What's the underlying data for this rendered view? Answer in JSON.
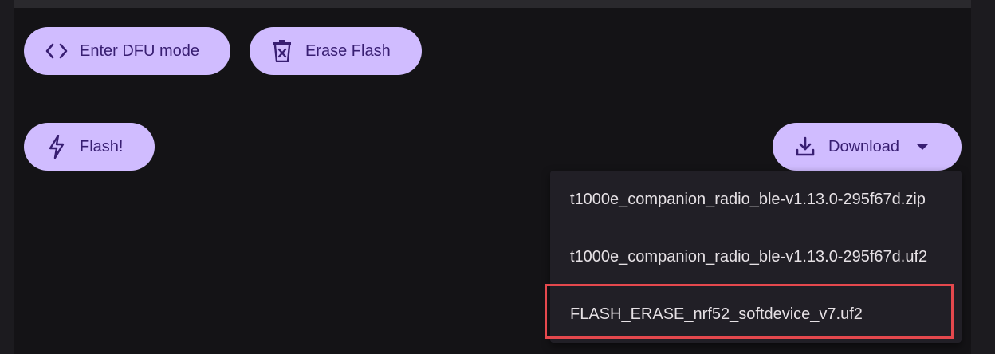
{
  "buttons": {
    "dfu": {
      "label": "Enter DFU mode",
      "icon": "code-icon"
    },
    "erase": {
      "label": "Erase Flash",
      "icon": "trash-icon"
    },
    "flash": {
      "label": "Flash!",
      "icon": "lightning-icon"
    },
    "download": {
      "label": "Download",
      "icon": "download-icon"
    }
  },
  "download_menu": {
    "items": [
      {
        "label": "t1000e_companion_radio_ble-v1.13.0-295f67d.zip"
      },
      {
        "label": "t1000e_companion_radio_ble-v1.13.0-295f67d.uf2"
      },
      {
        "label": "FLASH_ERASE_nrf52_softdevice_v7.uf2"
      }
    ],
    "highlighted_index": 2
  },
  "colors": {
    "button_bg": "#d0bcff",
    "button_text": "#381e72",
    "highlight_border": "#e5484d"
  }
}
